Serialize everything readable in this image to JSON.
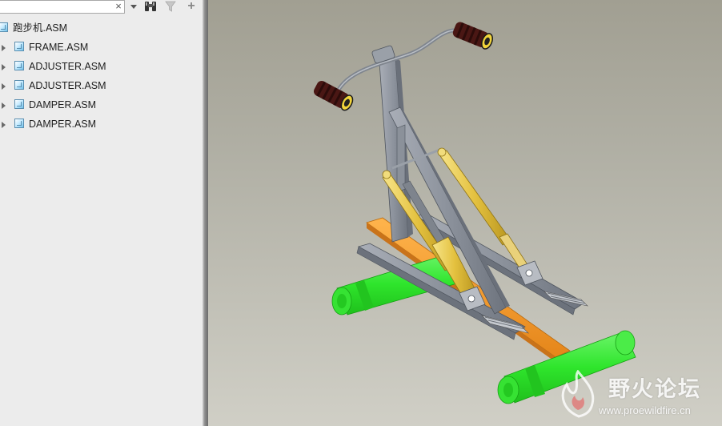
{
  "search": {
    "value": "",
    "placeholder": ""
  },
  "toolbar": {
    "clear_glyph": "×",
    "add_glyph": "+",
    "icons": [
      "chevron-down-icon",
      "find-icon",
      "filter-icon",
      "add-icon"
    ]
  },
  "tree": {
    "root": {
      "label": "跑步机.ASM",
      "icon": "assembly-icon"
    },
    "children": [
      {
        "label": "FRAME.ASM",
        "icon": "assembly-icon",
        "expandable": true
      },
      {
        "label": "ADJUSTER.ASM",
        "icon": "assembly-icon",
        "expandable": true
      },
      {
        "label": "ADJUSTER.ASM",
        "icon": "assembly-icon",
        "expandable": true
      },
      {
        "label": "DAMPER.ASM",
        "icon": "assembly-icon",
        "expandable": true
      },
      {
        "label": "DAMPER.ASM",
        "icon": "assembly-icon",
        "expandable": true
      }
    ]
  },
  "watermark": {
    "title": "野火论坛",
    "url": "www.proewildfire.cn"
  },
  "colors": {
    "frame": "#8e95a0",
    "damper": "#e6c447",
    "base": "#f39a2a",
    "roller": "#3ee23a",
    "grip": "#4a1714"
  }
}
